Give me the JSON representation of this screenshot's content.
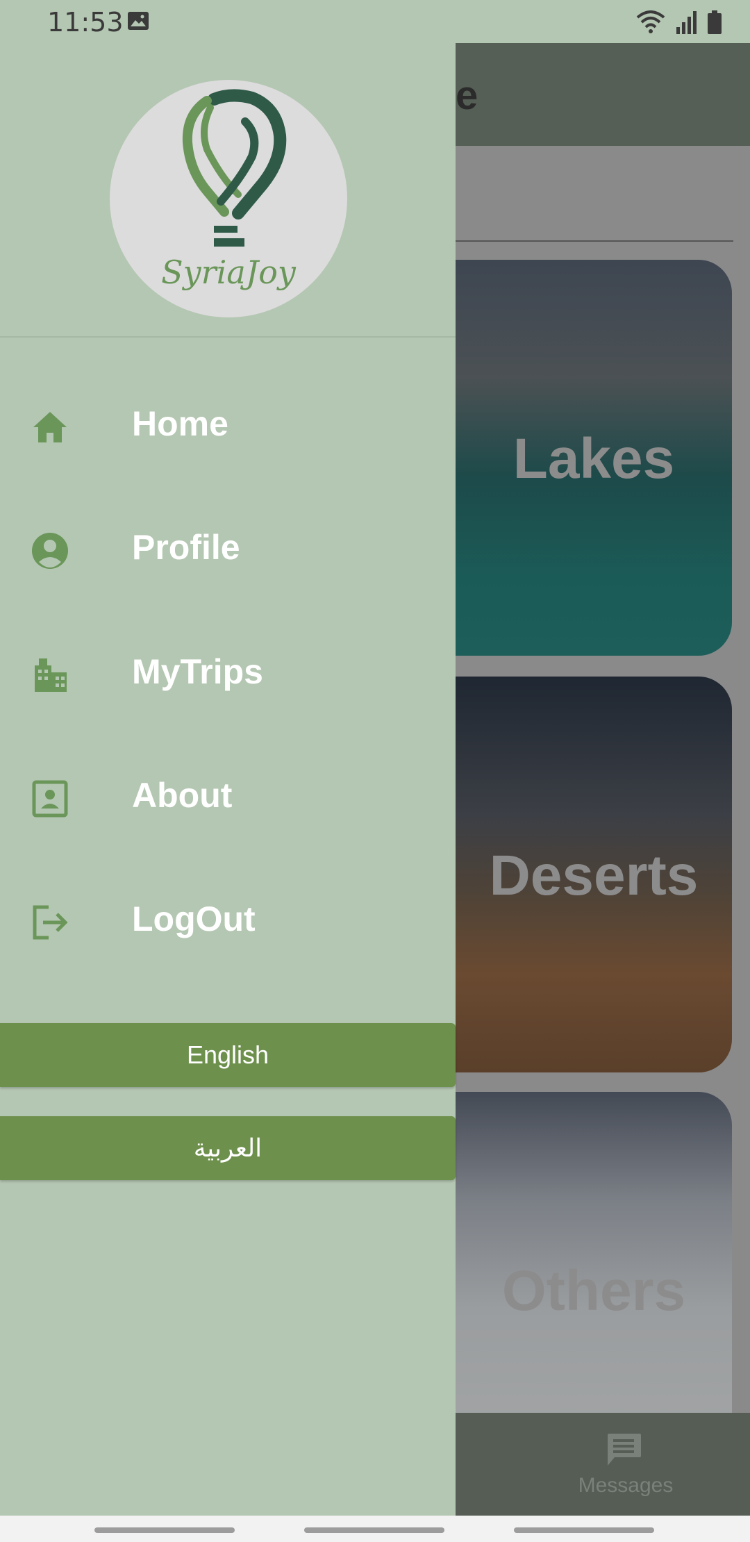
{
  "status_bar": {
    "time": "11:53",
    "icons": [
      "gallery-icon",
      "wifi-icon",
      "signal-icon",
      "battery-icon"
    ]
  },
  "drawer": {
    "logo_text": "SyriaJoy",
    "menu": [
      {
        "label": "Home",
        "icon": "home-icon"
      },
      {
        "label": "Profile",
        "icon": "account-circle-icon"
      },
      {
        "label": "MyTrips",
        "icon": "buildings-icon"
      },
      {
        "label": "About",
        "icon": "contact-card-icon"
      },
      {
        "label": "LogOut",
        "icon": "logout-icon"
      }
    ],
    "language_buttons": {
      "english": "English",
      "arabic": "العربية"
    }
  },
  "background_app": {
    "appbar_title_visible_fragment": "e",
    "cards": [
      {
        "label": "Lakes"
      },
      {
        "label": "Deserts"
      },
      {
        "label": "Others"
      }
    ],
    "bottom_nav": {
      "messages_label": "Messages"
    }
  },
  "colors": {
    "drawer_bg": "#b4c7b2",
    "accent_green": "#6e904d",
    "icon_green": "#6a9659"
  }
}
